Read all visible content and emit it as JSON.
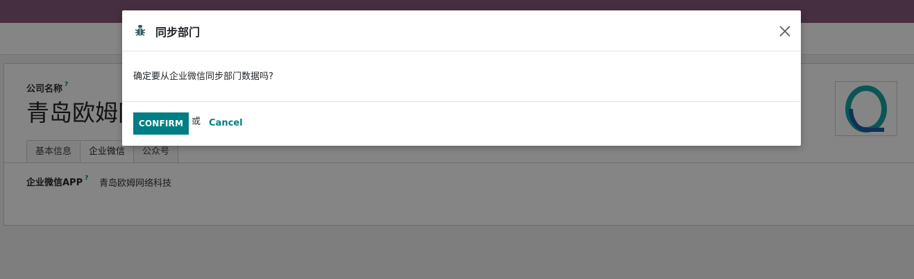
{
  "background": {
    "company_label": "公司名称",
    "help_mark": "?",
    "company_name": "青岛欧姆网",
    "tabs": [
      {
        "label": "基本信息"
      },
      {
        "label": "企业微信"
      },
      {
        "label": "公众号"
      }
    ],
    "app_label": "企业微信APP",
    "app_value": "青岛欧姆网络科技"
  },
  "dialog": {
    "icon": "bug-icon",
    "title": "同步部门",
    "message": "确定要从企业微信同步部门数据吗?",
    "confirm_label": "CONFIRM",
    "or_text": "或",
    "cancel_label": "Cancel"
  },
  "colors": {
    "accent": "#017e84",
    "topbar": "#875a7b"
  }
}
